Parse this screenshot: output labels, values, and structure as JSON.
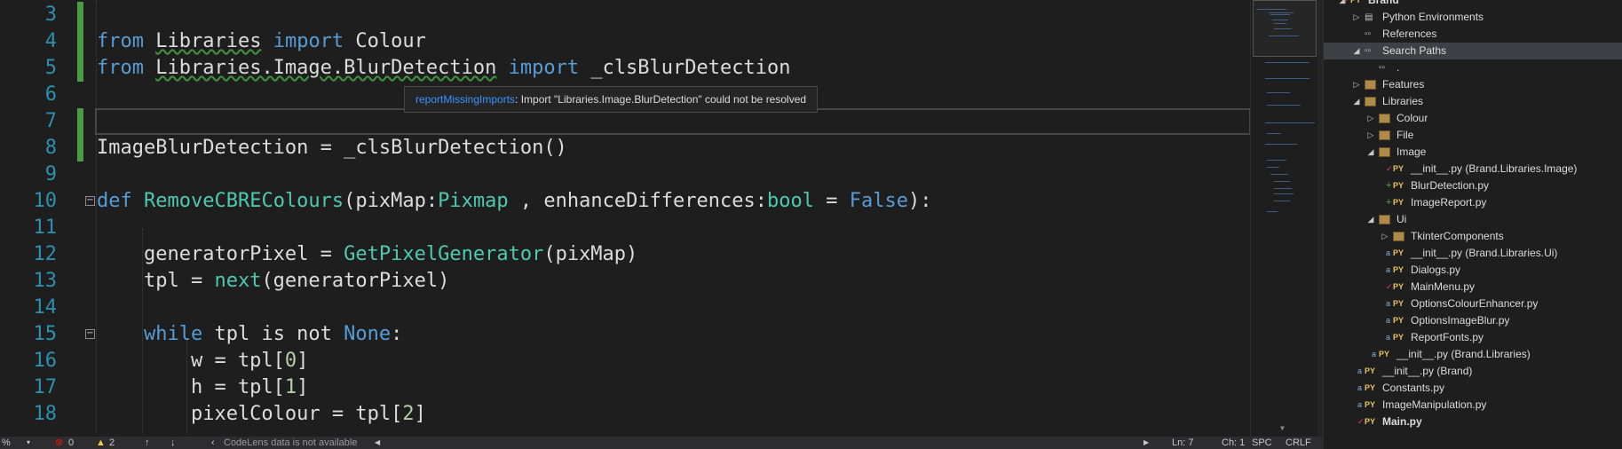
{
  "editor": {
    "lines": [
      {
        "n": "3",
        "segs": []
      },
      {
        "n": "4",
        "segs": [
          {
            "t": "from",
            "c": "kw"
          },
          {
            "t": " "
          },
          {
            "t": "Libraries",
            "c": "squig"
          },
          {
            "t": " "
          },
          {
            "t": "import",
            "c": "kw"
          },
          {
            "t": " Colour"
          }
        ]
      },
      {
        "n": "5",
        "segs": [
          {
            "t": "from",
            "c": "kw"
          },
          {
            "t": " "
          },
          {
            "t": "Libraries.Image.BlurDetection",
            "c": "squig"
          },
          {
            "t": " "
          },
          {
            "t": "import",
            "c": "kw"
          },
          {
            "t": " _clsBlurDetection"
          }
        ]
      },
      {
        "n": "6",
        "segs": []
      },
      {
        "n": "7",
        "segs": []
      },
      {
        "n": "8",
        "segs": [
          {
            "t": "ImageBlurDetection = _clsBlurDetection()"
          }
        ]
      },
      {
        "n": "9",
        "segs": []
      },
      {
        "n": "10",
        "segs": [
          {
            "t": "def",
            "c": "kw"
          },
          {
            "t": " "
          },
          {
            "t": "RemoveCBREColours",
            "c": "fn"
          },
          {
            "t": "(pixMap:"
          },
          {
            "t": "Pixmap",
            "c": "fn"
          },
          {
            "t": " , enhanceDifferences:"
          },
          {
            "t": "bool",
            "c": "fn"
          },
          {
            "t": " = "
          },
          {
            "t": "False",
            "c": "kw"
          },
          {
            "t": "):"
          }
        ]
      },
      {
        "n": "11",
        "segs": []
      },
      {
        "n": "12",
        "segs": [
          {
            "t": "    generatorPixel = "
          },
          {
            "t": "GetPixelGenerator",
            "c": "fn"
          },
          {
            "t": "(pixMap)"
          }
        ]
      },
      {
        "n": "13",
        "segs": [
          {
            "t": "    tpl = "
          },
          {
            "t": "next",
            "c": "fn"
          },
          {
            "t": "(generatorPixel)"
          }
        ]
      },
      {
        "n": "14",
        "segs": []
      },
      {
        "n": "15",
        "segs": [
          {
            "t": "    "
          },
          {
            "t": "while",
            "c": "kw"
          },
          {
            "t": " tpl is not "
          },
          {
            "t": "None",
            "c": "kw"
          },
          {
            "t": ":"
          }
        ]
      },
      {
        "n": "16",
        "segs": [
          {
            "t": "        w = tpl["
          },
          {
            "t": "0",
            "c": "num"
          },
          {
            "t": "]"
          }
        ]
      },
      {
        "n": "17",
        "segs": [
          {
            "t": "        h = tpl["
          },
          {
            "t": "1",
            "c": "num"
          },
          {
            "t": "]"
          }
        ]
      },
      {
        "n": "18",
        "segs": [
          {
            "t": "        pixelColour = tpl["
          },
          {
            "t": "2",
            "c": "num"
          },
          {
            "t": "]"
          }
        ]
      }
    ],
    "tooltip": {
      "rule": "reportMissingImports",
      "message": ": Import \"Libraries.Image.BlurDetection\" could not be resolved"
    }
  },
  "explorer": {
    "nodes": [
      {
        "label": "Brand",
        "icon": "python-project-icon",
        "depth": 0,
        "expander": "expanded",
        "status": "check",
        "bold": true
      },
      {
        "label": "Python Environments",
        "icon": "environments-icon",
        "depth": 1,
        "expander": "collapsed"
      },
      {
        "label": "References",
        "icon": "references-icon",
        "depth": 1,
        "expander": ""
      },
      {
        "label": "Search Paths",
        "icon": "search-paths-icon",
        "depth": 1,
        "expander": "expanded",
        "selected": true
      },
      {
        "label": ".",
        "icon": "search-paths-icon",
        "depth": 2,
        "expander": ""
      },
      {
        "label": "Features",
        "icon": "folder-icon",
        "depth": 1,
        "expander": "collapsed"
      },
      {
        "label": "Libraries",
        "icon": "folder-icon",
        "depth": 1,
        "expander": "expanded"
      },
      {
        "label": "Colour",
        "icon": "folder-icon",
        "depth": 2,
        "expander": "collapsed"
      },
      {
        "label": "File",
        "icon": "folder-icon",
        "depth": 2,
        "expander": "collapsed"
      },
      {
        "label": "Image",
        "icon": "folder-icon",
        "depth": 2,
        "expander": "expanded"
      },
      {
        "label": "__init__.py (Brand.Libraries.Image)",
        "icon": "python-file-icon",
        "depth": 3,
        "expander": "",
        "status": "check"
      },
      {
        "label": "BlurDetection.py",
        "icon": "python-file-icon",
        "depth": 3,
        "expander": "",
        "status": "plus"
      },
      {
        "label": "ImageReport.py",
        "icon": "python-file-icon",
        "depth": 3,
        "expander": "",
        "status": "plus"
      },
      {
        "label": "Ui",
        "icon": "folder-icon",
        "depth": 2,
        "expander": "expanded"
      },
      {
        "label": "TkinterComponents",
        "icon": "folder-icon",
        "depth": 3,
        "expander": "collapsed"
      },
      {
        "label": "__init__.py (Brand.Libraries.Ui)",
        "icon": "python-file-icon",
        "depth": 3,
        "expander": "",
        "status": "lock"
      },
      {
        "label": "Dialogs.py",
        "icon": "python-file-icon",
        "depth": 3,
        "expander": "",
        "status": "lock"
      },
      {
        "label": "MainMenu.py",
        "icon": "python-file-icon",
        "depth": 3,
        "expander": "",
        "status": "check"
      },
      {
        "label": "OptionsColourEnhancer.py",
        "icon": "python-file-icon",
        "depth": 3,
        "expander": "",
        "status": "lock"
      },
      {
        "label": "OptionsImageBlur.py",
        "icon": "python-file-icon",
        "depth": 3,
        "expander": "",
        "status": "lock"
      },
      {
        "label": "ReportFonts.py",
        "icon": "python-file-icon",
        "depth": 3,
        "expander": "",
        "status": "lock"
      },
      {
        "label": "__init__.py (Brand.Libraries)",
        "icon": "python-file-icon",
        "depth": 2,
        "expander": "",
        "status": "lock"
      },
      {
        "label": "__init__.py (Brand)",
        "icon": "python-file-icon",
        "depth": 1,
        "expander": "",
        "status": "lock"
      },
      {
        "label": "Constants.py",
        "icon": "python-file-icon",
        "depth": 1,
        "expander": "",
        "status": "lock"
      },
      {
        "label": "ImageManipulation.py",
        "icon": "python-file-icon",
        "depth": 1,
        "expander": "",
        "status": "lock"
      },
      {
        "label": "Main.py",
        "icon": "python-file-icon",
        "depth": 1,
        "expander": "",
        "status": "check",
        "bold": true
      }
    ]
  },
  "status": {
    "zoom": "%",
    "errors": "0",
    "warnings": "2",
    "codelens": "CodeLens data is not available",
    "ln": "Ln: 7",
    "ch": "Ch: 1",
    "spc": "SPC",
    "crlf": "CRLF"
  },
  "colors": {
    "keyword": "#569cd6",
    "type": "#4ec9b0",
    "number": "#b5cea8",
    "change_bar": "#4b9c42",
    "line_number": "#2b91af"
  }
}
